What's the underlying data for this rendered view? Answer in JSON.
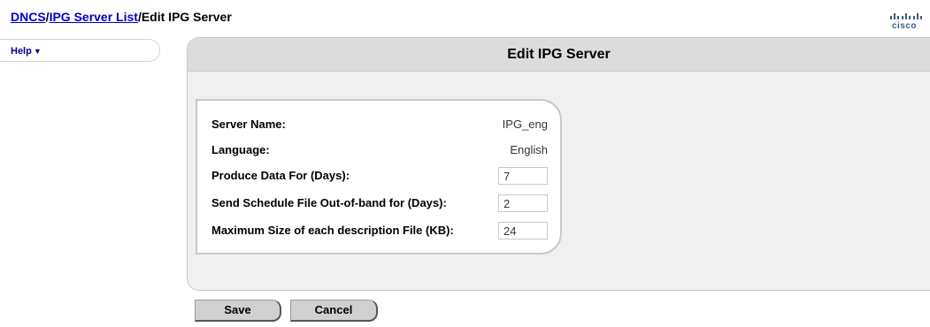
{
  "breadcrumb": {
    "items": [
      "DNCS",
      "IPG Server List"
    ],
    "separator": "/",
    "current": "Edit IPG Server"
  },
  "logo": {
    "word": "cisco"
  },
  "help": {
    "label": "Help",
    "arrow": "▼"
  },
  "panel": {
    "title": "Edit IPG Server"
  },
  "form": {
    "server_name": {
      "label": "Server Name:",
      "value": "IPG_eng"
    },
    "language": {
      "label": "Language:",
      "value": "English"
    },
    "produce_days": {
      "label": "Produce Data For (Days):",
      "value": "7"
    },
    "schedule_days": {
      "label": "Send Schedule File Out-of-band for (Days):",
      "value": "2"
    },
    "max_size": {
      "label": "Maximum Size of each description File (KB):",
      "value": "24"
    }
  },
  "buttons": {
    "save": "Save",
    "cancel": "Cancel"
  }
}
